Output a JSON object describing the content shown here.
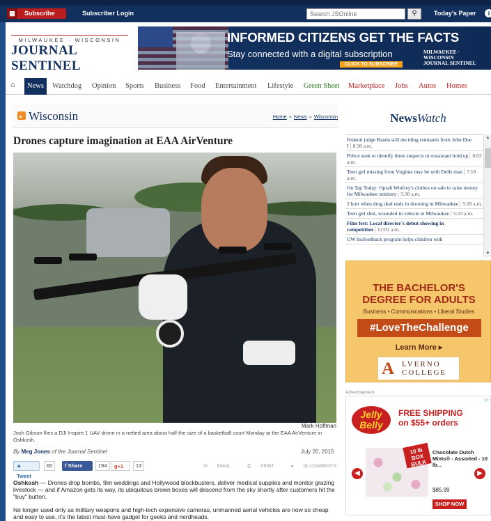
{
  "topbar": {
    "subscribe_label": "Subscribe",
    "login_label": "Subscriber Login",
    "search_placeholder": "Search JSOnline",
    "todays_paper_label": "Today's Paper"
  },
  "masthead": {
    "logo_line1": "MILWAUKEE · WISCONSIN",
    "logo_line2": "JOURNAL SENTINEL"
  },
  "banner_ad": {
    "headline": "INFORMED CITIZENS GET THE FACTS",
    "subline": "Stay connected with a digital subscription",
    "cta": "CLICK TO SUBSCRIBE",
    "mini_logo": "MILWAUKEE · WISCONSIN JOURNAL SENTINEL"
  },
  "nav": {
    "items": [
      "News",
      "Watchdog",
      "Opinion",
      "Sports",
      "Business",
      "Food",
      "Entertainment",
      "Lifestyle",
      "Green Sheet",
      "Marketplace",
      "Jobs",
      "Autos",
      "Homes"
    ]
  },
  "section": {
    "name": "Wisconsin",
    "breadcrumb": [
      "Home",
      "News",
      "Wisconsin"
    ]
  },
  "article": {
    "headline": "Drones capture imagination at EAA AirVenture",
    "photo_credit": "Mark Hoffman",
    "caption": "Josh Gibson flies a DJI Inspire 1 UAV drone in a netted area about half the size of a basketball court Monday at the EAA AirVenture in Oshkosh.",
    "byline_prefix": "By",
    "author": "Meg Jones",
    "byline_suffix": "of the Journal Sentinel",
    "date": "July 20, 2015",
    "para1_lead": "Oshkosh",
    "para1": " — Drones drop bombs, film weddings and Hollywood blockbusters, deliver medical supplies and monitor grazing livestock — and if Amazon gets its way, its ubiquitous brown boxes will descend from the sky shortly after customers hit the \"buy\" button.",
    "para2": "No longer used only as military weapons and high-tech expensive cameras, unmanned aerial vehicles are now so cheap and easy to use, it's the latest must-have gadget for geeks and nerdheads."
  },
  "share": {
    "tweet_label": "Tweet",
    "tweet_count": "60",
    "fb_label": "Share",
    "fb_count": "194",
    "gplus_label": "g+1",
    "gplus_count": "13",
    "email_label": "EMAIL",
    "print_label": "PRINT",
    "comments_label": "(8) COMMENTS"
  },
  "newswatch": {
    "title_a": "News",
    "title_b": "Watch",
    "items": [
      {
        "text": "Federal judge Randa still deciding remnants from John Doe I",
        "time": "8:30 a.m."
      },
      {
        "text": "Police seek to identify three suspects in restaurant hold up",
        "time": "8:03 a.m."
      },
      {
        "text": "Teen girl missing from Virginia may be with Dells man",
        "time": "7:18 a.m."
      },
      {
        "text": "On Tap Today: Oprah Winfrey's clothes on sale to raise money for Milwaukee ministry",
        "time": "5:30 a.m."
      },
      {
        "text": "2 hurt when drug deal ends in shooting in Milwaukee",
        "time": "5:28 a.m."
      },
      {
        "text": "Teen girl shot, wounded in vehicle in Milwaukee",
        "time": "5:23 a.m."
      },
      {
        "text": "Film fest: Local director's debut showing in competition",
        "time": "12:01 a.m."
      },
      {
        "text": "UW biofeedback program helps children with",
        "time": ""
      }
    ]
  },
  "ad_alverno": {
    "line1": "THE BACHELOR'S",
    "line2": "DEGREE FOR ADULTS",
    "line3": "Business • Communications • Liberal Studies",
    "tag": "#LoveTheChallenge",
    "more": "Learn More ▸",
    "logo_letter": "A",
    "logo_word1": "LVERNO",
    "logo_word2": "COLLEGE"
  },
  "ad_jellybelly": {
    "label": "Advertisement",
    "brand": "Jelly Belly",
    "shipping_line1": "FREE SHIPPING",
    "shipping_line2": "on $55+ orders",
    "box": "10 lb BOX BULK",
    "product": "Chocolate Dutch Mints® - Assorted - 10 lb...",
    "price": "$85.99",
    "shop_label": "SHOP NOW",
    "ad_choice": "▷"
  },
  "colors": {
    "brand_navy": "#12305e",
    "subscribe_red": "#b91d1d",
    "green_sheet": "#2a7a1e"
  },
  "icons": [
    "calendar-icon",
    "search-icon",
    "info-icon",
    "home-icon",
    "rss-icon",
    "twitter-icon",
    "facebook-icon",
    "email-icon",
    "print-icon",
    "comment-icon"
  ]
}
